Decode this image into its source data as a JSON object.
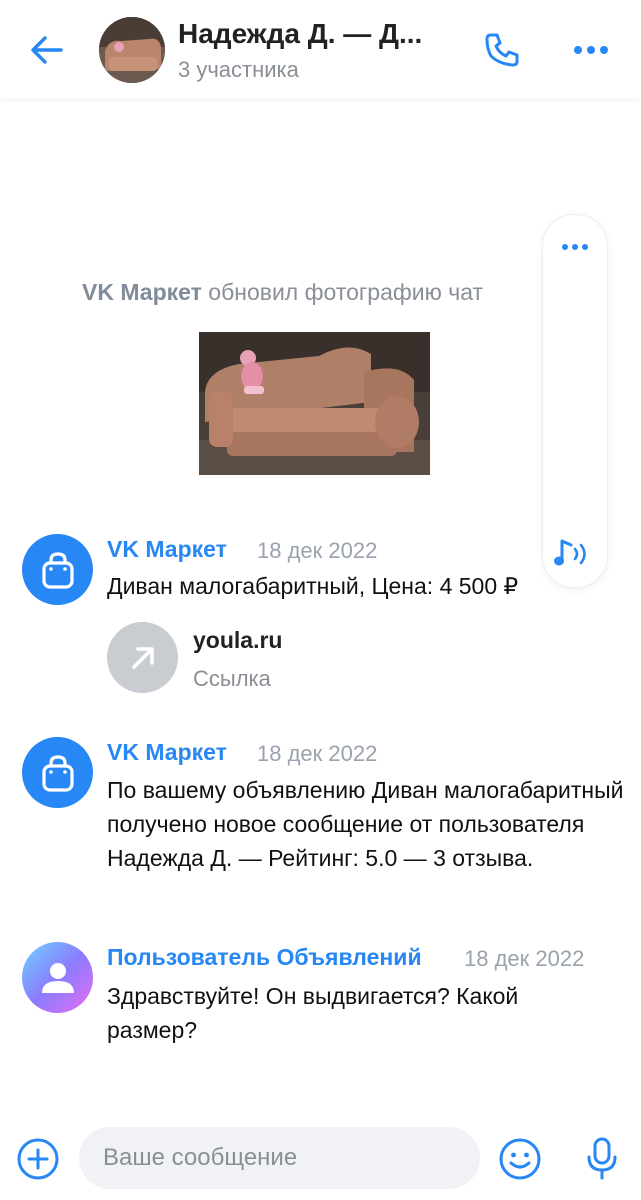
{
  "header": {
    "title": "Надежда Д. — Д...",
    "subtitle": "3 участника"
  },
  "service_message": {
    "actor": "VK Маркет",
    "action": " обновил фотографию чат"
  },
  "messages": [
    {
      "author": "VK Маркет",
      "time": "18 дек 2022",
      "text": "Диван малогабаритный, Цена: 4 500 ₽",
      "link": {
        "title": "youla.ru",
        "subtitle": "Ссылка"
      }
    },
    {
      "author": "VK Маркет",
      "time": "18 дек 2022",
      "text": "По вашему объявлению Диван малогабаритный получено новое сообщение от пользователя Надежда Д. — Рейтинг: 5.0 — 3 отзыва."
    },
    {
      "author": "Пользователь Объявлений",
      "time": "18 дек 2022",
      "text": "Здравствуйте! Он выдвигается? Какой размер?"
    }
  ],
  "composer": {
    "placeholder": "Ваше сообщение",
    "value": ""
  },
  "colors": {
    "accent": "#2787f5",
    "secondary_text": "#8a8f96",
    "input_bg": "#f0f2f5"
  },
  "icons": [
    "arrow-left-icon",
    "phone-icon",
    "more-dots-icon",
    "shopping-bag-icon",
    "arrow-up-right-icon",
    "user-icon",
    "plus-circle-icon",
    "smile-icon",
    "microphone-icon",
    "audio-note-icon"
  ]
}
